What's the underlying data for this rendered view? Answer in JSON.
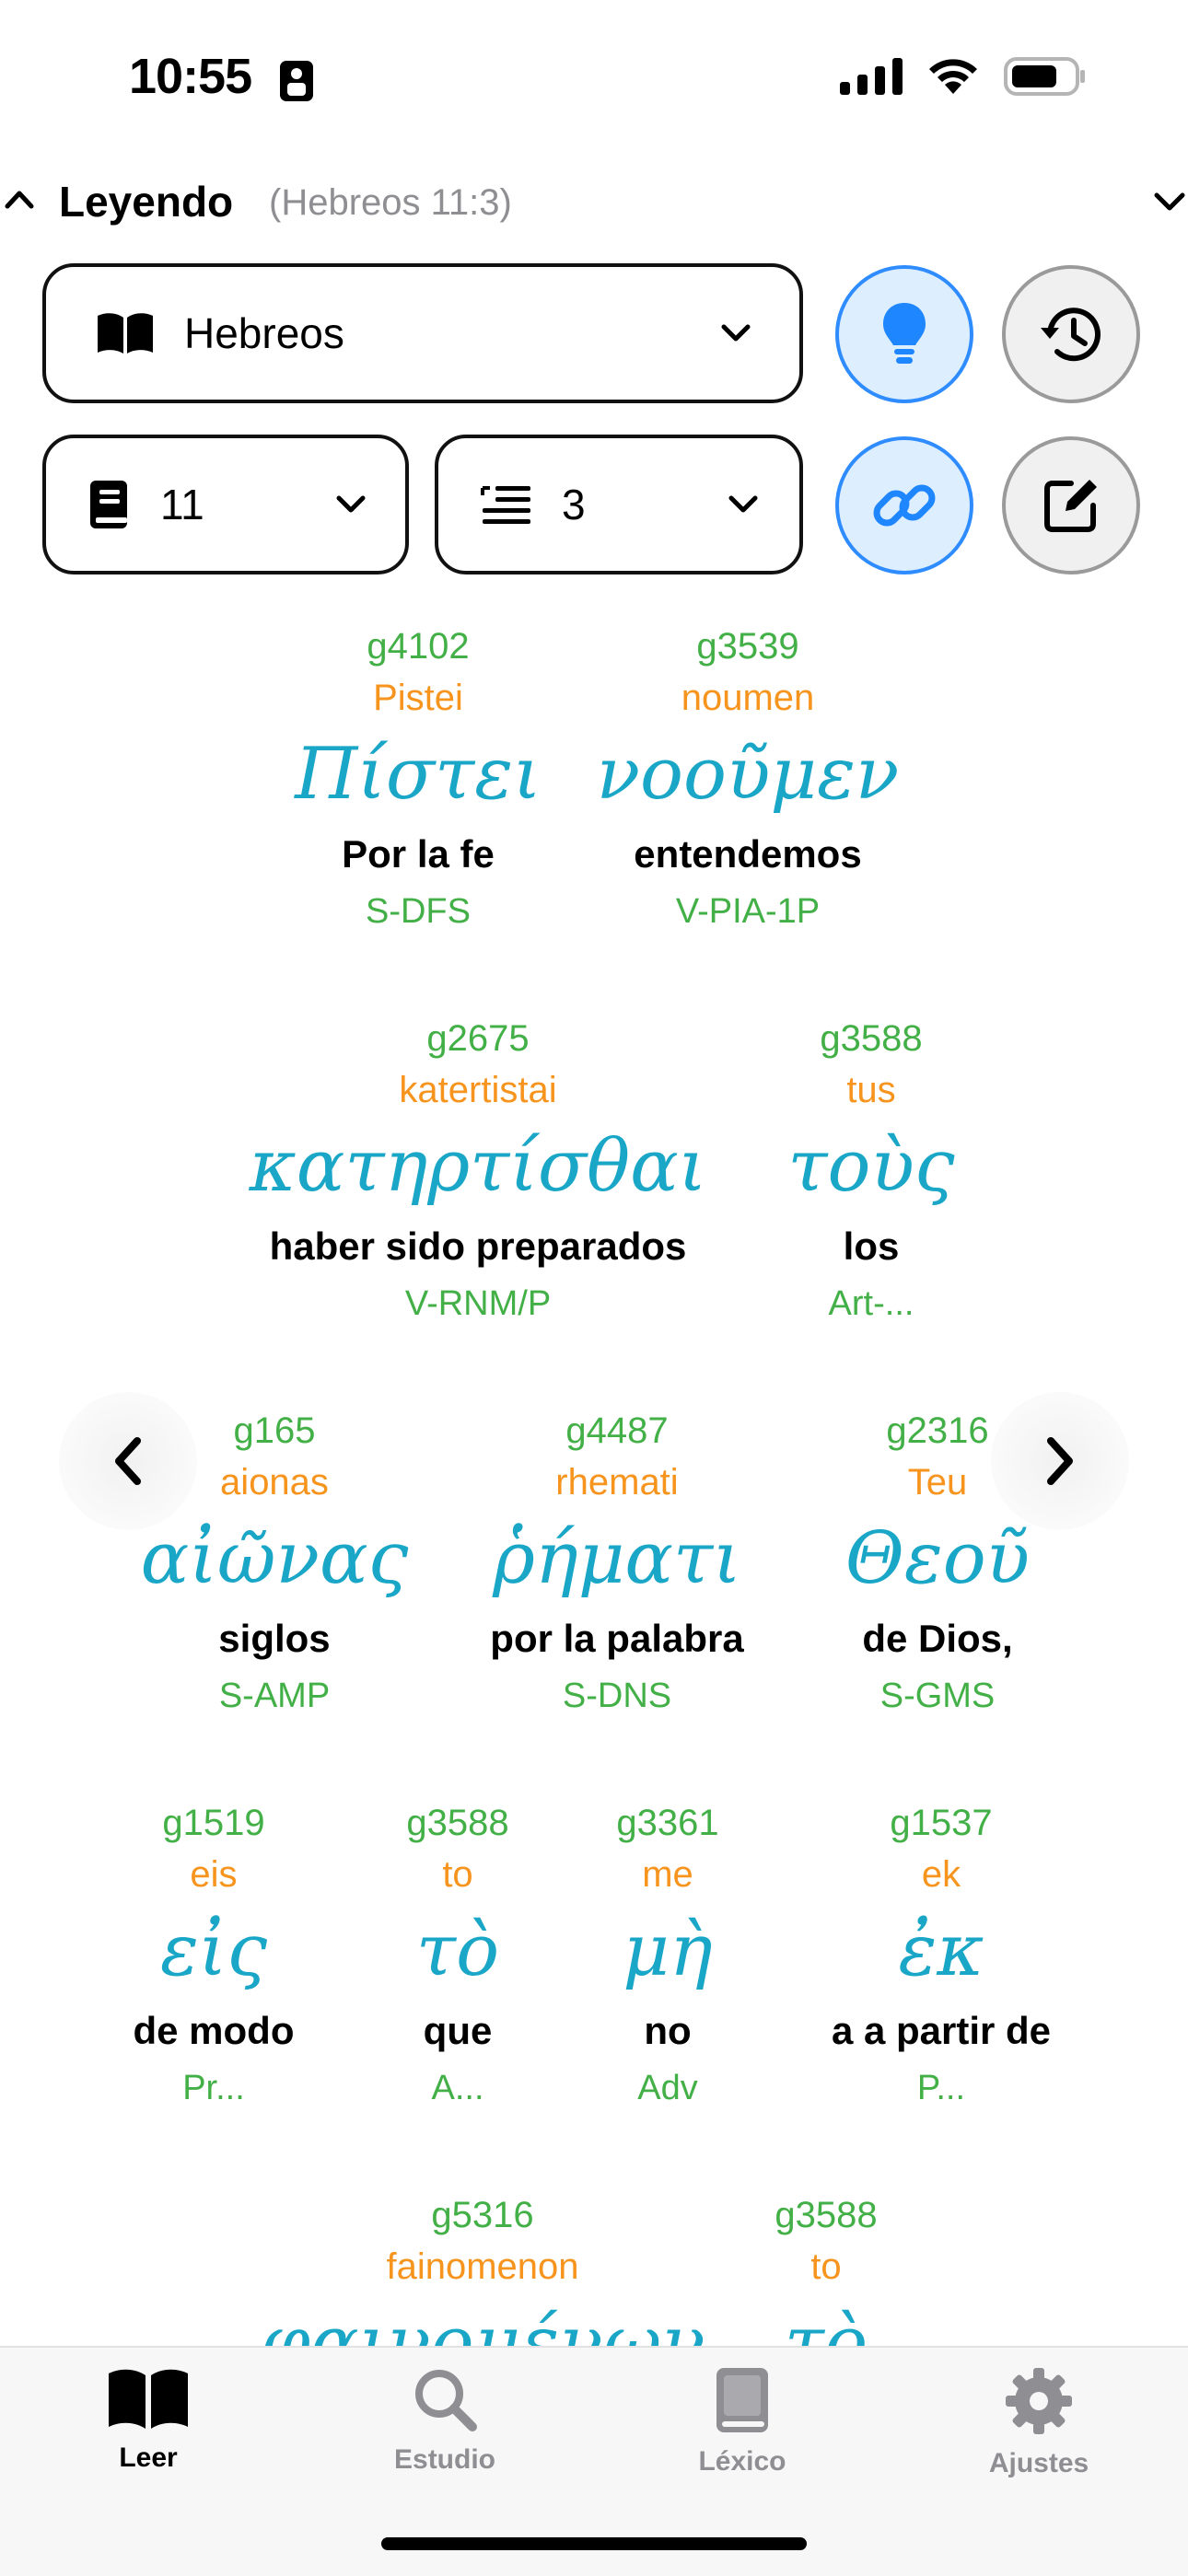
{
  "status_bar": {
    "time": "10:55"
  },
  "header": {
    "title": "Leyendo",
    "reference": "(Hebreos 11:3)"
  },
  "selectors": {
    "book": "Hebreos",
    "chapter": "11",
    "verse": "3"
  },
  "rows": [
    {
      "words": [
        {
          "strong": "g4102",
          "translit": "Pistei",
          "greek": "Πίστει",
          "gloss": "Por la fe",
          "morph": "S-DFS"
        },
        {
          "strong": "g3539",
          "translit": "noumen",
          "greek": "νοοῦμεν",
          "gloss": "entendemos",
          "morph": "V-PIA-1P"
        }
      ]
    },
    {
      "words": [
        {
          "strong": "g2675",
          "translit": "katertistai",
          "greek": "κατηρτίσθαι",
          "gloss": "haber sido preparados",
          "morph": "V-RNM/P"
        },
        {
          "strong": "g3588",
          "translit": "tus",
          "greek": "τοὺς",
          "gloss": "los",
          "morph": "Art-..."
        }
      ]
    },
    {
      "words": [
        {
          "strong": "g165",
          "translit": "aionas",
          "greek": "αἰῶνας",
          "gloss": "siglos",
          "morph": "S-AMP"
        },
        {
          "strong": "g4487",
          "translit": "rhemati",
          "greek": "ῥήματι",
          "gloss": "por la palabra",
          "morph": "S-DNS"
        },
        {
          "strong": "g2316",
          "translit": "Teu",
          "greek": "Θεοῦ",
          "gloss": "de Dios,",
          "morph": "S-GMS"
        }
      ]
    },
    {
      "words": [
        {
          "strong": "g1519",
          "translit": "eis",
          "greek": "εἰς",
          "gloss": "de modo",
          "morph": "Pr..."
        },
        {
          "strong": "g3588",
          "translit": "to",
          "greek": "τὸ",
          "gloss": "que",
          "morph": "A..."
        },
        {
          "strong": "g3361",
          "translit": "me",
          "greek": "μὴ",
          "gloss": "no",
          "morph": "Adv"
        },
        {
          "strong": "g1537",
          "translit": "ek",
          "greek": "ἐκ",
          "gloss": "a a partir de",
          "morph": "P..."
        }
      ]
    },
    {
      "words": [
        {
          "strong": "g5316",
          "translit": "fainomenon",
          "greek": "φαινομένων",
          "gloss": "",
          "morph": ""
        },
        {
          "strong": "g3588",
          "translit": "to",
          "greek": "τὸ",
          "gloss": "",
          "morph": ""
        }
      ]
    }
  ],
  "tabs": [
    {
      "label": "Leer",
      "icon": "book-open-icon",
      "active": true
    },
    {
      "label": "Estudio",
      "icon": "magnifier-icon",
      "active": false
    },
    {
      "label": "Léxico",
      "icon": "lexicon-book-icon",
      "active": false
    },
    {
      "label": "Ajustes",
      "icon": "gear-icon",
      "active": false
    }
  ],
  "colors": {
    "accent": "#2f8cff",
    "strong": "#43b047",
    "translit": "#f7941d",
    "greek": "#1aa6c6"
  }
}
